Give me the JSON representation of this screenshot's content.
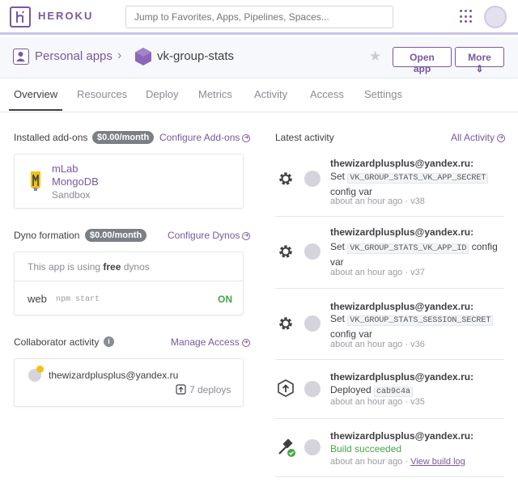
{
  "header": {
    "brand": "HEROKU",
    "search_placeholder": "Jump to Favorites, Apps, Pipelines, Spaces..."
  },
  "appbar": {
    "personal_label": "Personal apps",
    "app_name": "vk-group-stats",
    "open_app": "Open app",
    "more": "More"
  },
  "tabs": [
    "Overview",
    "Resources",
    "Deploy",
    "Metrics",
    "Activity",
    "Access",
    "Settings"
  ],
  "addons": {
    "title": "Installed add-ons",
    "price": "$0.00/month",
    "configure": "Configure Add-ons",
    "item": {
      "name_line1": "mLab",
      "name_line2": "MongoDB",
      "plan": "Sandbox"
    }
  },
  "dynos": {
    "title": "Dyno formation",
    "price": "$0.00/month",
    "configure": "Configure Dynos",
    "info_prefix": "This app is using ",
    "info_bold": "free",
    "info_suffix": " dynos",
    "web_label": "web",
    "web_cmd": "npm start",
    "web_state": "ON"
  },
  "collaborators": {
    "title": "Collaborator activity",
    "manage": "Manage Access",
    "email": "thewizardplusplus@yandex.ru",
    "deploys": "7 deploys"
  },
  "activity": {
    "title": "Latest activity",
    "all": "All Activity",
    "items": [
      {
        "user": "thewizardplusplus@yandex.ru:",
        "action": "Set",
        "code": "VK_GROUP_STATS_VK_APP_SECRET",
        "suffix": "config var",
        "time": "about an hour ago",
        "version": "v38"
      },
      {
        "user": "thewizardplusplus@yandex.ru:",
        "action": "Set",
        "code": "VK_GROUP_STATS_VK_APP_ID",
        "suffix": "config var",
        "time": "about an hour ago",
        "version": "v37"
      },
      {
        "user": "thewizardplusplus@yandex.ru:",
        "action": "Set",
        "code": "VK_GROUP_STATS_SESSION_SECRET",
        "suffix": "config var",
        "time": "about an hour ago",
        "version": "v36"
      },
      {
        "user": "thewizardplusplus@yandex.ru:",
        "action": "Deployed",
        "code": "cab9c4a",
        "suffix": "",
        "time": "about an hour ago",
        "version": "v35"
      },
      {
        "user": "thewizardplusplus@yandex.ru:",
        "action": "Build succeeded",
        "time": "about an hour ago",
        "link": "View build log"
      }
    ]
  },
  "colors": {
    "brand": "#79589f",
    "success": "#46a546"
  }
}
